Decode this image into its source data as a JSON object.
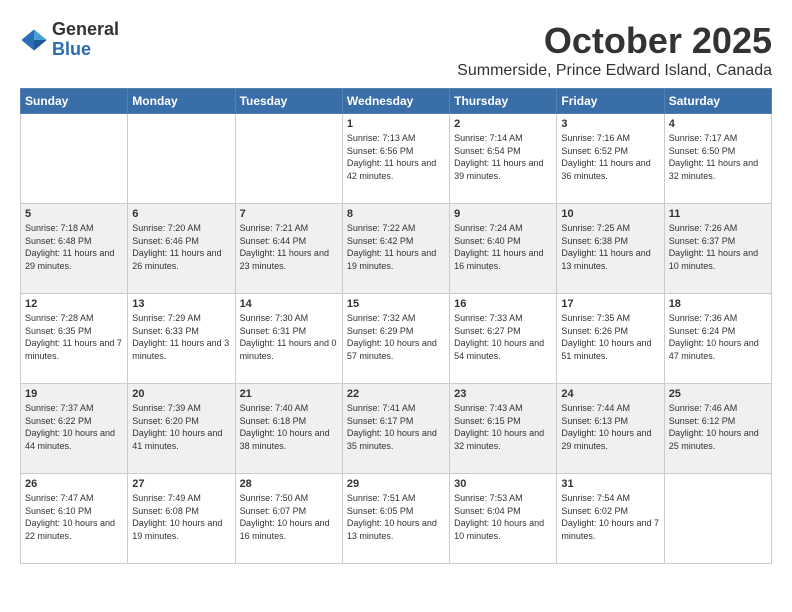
{
  "logo": {
    "general": "General",
    "blue": "Blue"
  },
  "title": "October 2025",
  "subtitle": "Summerside, Prince Edward Island, Canada",
  "days_of_week": [
    "Sunday",
    "Monday",
    "Tuesday",
    "Wednesday",
    "Thursday",
    "Friday",
    "Saturday"
  ],
  "weeks": [
    [
      {
        "day": "",
        "text": ""
      },
      {
        "day": "",
        "text": ""
      },
      {
        "day": "",
        "text": ""
      },
      {
        "day": "1",
        "text": "Sunrise: 7:13 AM\nSunset: 6:56 PM\nDaylight: 11 hours and 42 minutes."
      },
      {
        "day": "2",
        "text": "Sunrise: 7:14 AM\nSunset: 6:54 PM\nDaylight: 11 hours and 39 minutes."
      },
      {
        "day": "3",
        "text": "Sunrise: 7:16 AM\nSunset: 6:52 PM\nDaylight: 11 hours and 36 minutes."
      },
      {
        "day": "4",
        "text": "Sunrise: 7:17 AM\nSunset: 6:50 PM\nDaylight: 11 hours and 32 minutes."
      }
    ],
    [
      {
        "day": "5",
        "text": "Sunrise: 7:18 AM\nSunset: 6:48 PM\nDaylight: 11 hours and 29 minutes."
      },
      {
        "day": "6",
        "text": "Sunrise: 7:20 AM\nSunset: 6:46 PM\nDaylight: 11 hours and 26 minutes."
      },
      {
        "day": "7",
        "text": "Sunrise: 7:21 AM\nSunset: 6:44 PM\nDaylight: 11 hours and 23 minutes."
      },
      {
        "day": "8",
        "text": "Sunrise: 7:22 AM\nSunset: 6:42 PM\nDaylight: 11 hours and 19 minutes."
      },
      {
        "day": "9",
        "text": "Sunrise: 7:24 AM\nSunset: 6:40 PM\nDaylight: 11 hours and 16 minutes."
      },
      {
        "day": "10",
        "text": "Sunrise: 7:25 AM\nSunset: 6:38 PM\nDaylight: 11 hours and 13 minutes."
      },
      {
        "day": "11",
        "text": "Sunrise: 7:26 AM\nSunset: 6:37 PM\nDaylight: 11 hours and 10 minutes."
      }
    ],
    [
      {
        "day": "12",
        "text": "Sunrise: 7:28 AM\nSunset: 6:35 PM\nDaylight: 11 hours and 7 minutes."
      },
      {
        "day": "13",
        "text": "Sunrise: 7:29 AM\nSunset: 6:33 PM\nDaylight: 11 hours and 3 minutes."
      },
      {
        "day": "14",
        "text": "Sunrise: 7:30 AM\nSunset: 6:31 PM\nDaylight: 11 hours and 0 minutes."
      },
      {
        "day": "15",
        "text": "Sunrise: 7:32 AM\nSunset: 6:29 PM\nDaylight: 10 hours and 57 minutes."
      },
      {
        "day": "16",
        "text": "Sunrise: 7:33 AM\nSunset: 6:27 PM\nDaylight: 10 hours and 54 minutes."
      },
      {
        "day": "17",
        "text": "Sunrise: 7:35 AM\nSunset: 6:26 PM\nDaylight: 10 hours and 51 minutes."
      },
      {
        "day": "18",
        "text": "Sunrise: 7:36 AM\nSunset: 6:24 PM\nDaylight: 10 hours and 47 minutes."
      }
    ],
    [
      {
        "day": "19",
        "text": "Sunrise: 7:37 AM\nSunset: 6:22 PM\nDaylight: 10 hours and 44 minutes."
      },
      {
        "day": "20",
        "text": "Sunrise: 7:39 AM\nSunset: 6:20 PM\nDaylight: 10 hours and 41 minutes."
      },
      {
        "day": "21",
        "text": "Sunrise: 7:40 AM\nSunset: 6:18 PM\nDaylight: 10 hours and 38 minutes."
      },
      {
        "day": "22",
        "text": "Sunrise: 7:41 AM\nSunset: 6:17 PM\nDaylight: 10 hours and 35 minutes."
      },
      {
        "day": "23",
        "text": "Sunrise: 7:43 AM\nSunset: 6:15 PM\nDaylight: 10 hours and 32 minutes."
      },
      {
        "day": "24",
        "text": "Sunrise: 7:44 AM\nSunset: 6:13 PM\nDaylight: 10 hours and 29 minutes."
      },
      {
        "day": "25",
        "text": "Sunrise: 7:46 AM\nSunset: 6:12 PM\nDaylight: 10 hours and 25 minutes."
      }
    ],
    [
      {
        "day": "26",
        "text": "Sunrise: 7:47 AM\nSunset: 6:10 PM\nDaylight: 10 hours and 22 minutes."
      },
      {
        "day": "27",
        "text": "Sunrise: 7:49 AM\nSunset: 6:08 PM\nDaylight: 10 hours and 19 minutes."
      },
      {
        "day": "28",
        "text": "Sunrise: 7:50 AM\nSunset: 6:07 PM\nDaylight: 10 hours and 16 minutes."
      },
      {
        "day": "29",
        "text": "Sunrise: 7:51 AM\nSunset: 6:05 PM\nDaylight: 10 hours and 13 minutes."
      },
      {
        "day": "30",
        "text": "Sunrise: 7:53 AM\nSunset: 6:04 PM\nDaylight: 10 hours and 10 minutes."
      },
      {
        "day": "31",
        "text": "Sunrise: 7:54 AM\nSunset: 6:02 PM\nDaylight: 10 hours and 7 minutes."
      },
      {
        "day": "",
        "text": ""
      }
    ]
  ],
  "row_classes": [
    "row-white",
    "row-shaded",
    "row-white",
    "row-shaded",
    "row-white"
  ]
}
